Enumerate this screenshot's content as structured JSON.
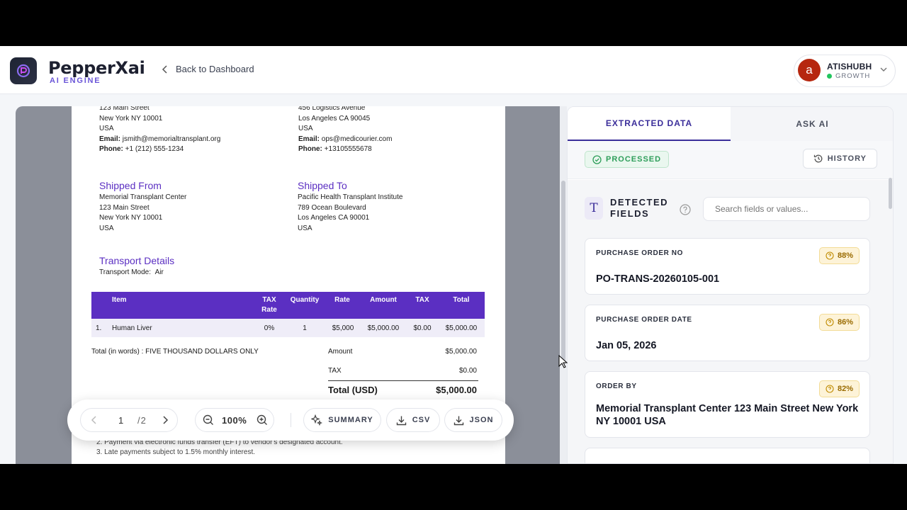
{
  "header": {
    "brand": "PepperXai",
    "brand_sub": "AI ENGINE",
    "back_label": "Back to Dashboard",
    "user": {
      "initial": "a",
      "name": "ATISHUBH",
      "plan": "GROWTH"
    }
  },
  "document": {
    "bill_from": {
      "l1": "123 Main Street",
      "l2": "New York NY  10001",
      "l3": "USA",
      "email_label": "Email:",
      "email": "jsmith@memorialtransplant.org",
      "phone_label": "Phone:",
      "phone": "+1 (212) 555-1234"
    },
    "bill_to": {
      "l0": "456 Logistics Avenue",
      "l1": "Los Angeles CA 90045",
      "l2": "USA",
      "email_label": "Email:",
      "email": "ops@medicourier.com",
      "phone_label": "Phone:",
      "phone": "+13105555678"
    },
    "shipped_from": {
      "title": "Shipped From",
      "l1": "Memorial Transplant Center",
      "l2": "123 Main Street",
      "l3": "New York NY  10001",
      "l4": "USA"
    },
    "shipped_to": {
      "title": "Shipped To",
      "l1": "Pacific Health Transplant Institute",
      "l2": "789 Ocean Boulevard",
      "l3": "Los Angeles CA 90001",
      "l4": "USA"
    },
    "transport": {
      "title": "Transport Details",
      "mode_label": "Transport Mode:",
      "mode": "Air"
    },
    "table": {
      "headers": {
        "item": "Item",
        "tax_rate_1": "TAX",
        "tax_rate_2": "Rate",
        "quantity": "Quantity",
        "rate": "Rate",
        "amount": "Amount",
        "tax": "TAX",
        "total": "Total"
      },
      "row": {
        "num": "1.",
        "item": "Human Liver",
        "tax_rate": "0%",
        "quantity": "1",
        "rate": "$5,000",
        "amount": "$5,000.00",
        "tax": "$0.00",
        "total": "$5,000.00"
      }
    },
    "total_words": "Total (in words) : FIVE THOUSAND DOLLARS ONLY",
    "summary": {
      "amount_label": "Amount",
      "amount": "$5,000.00",
      "tax_label": "TAX",
      "tax": "$0.00",
      "total_label": "Total (USD)",
      "total": "$5,000.00"
    },
    "notes": {
      "n2": "2. Payment via electronic funds transfer (EFT) to vendor's designated account.",
      "n3": "3. Late payments subject to 1.5% monthly interest."
    }
  },
  "toolbar": {
    "page": "1",
    "page_total": "/2",
    "zoom": "100%",
    "summary": "SUMMARY",
    "csv": "CSV",
    "json": "JSON"
  },
  "panel": {
    "tabs": {
      "extracted": "EXTRACTED DATA",
      "ask": "ASK AI"
    },
    "status": "PROCESSED",
    "history": "HISTORY",
    "fields_title_1": "DETECTED",
    "fields_title_2": "FIELDS",
    "search_placeholder": "Search fields or values...",
    "fields": [
      {
        "label": "PURCHASE ORDER NO",
        "confidence": "88%",
        "value": "PO-TRANS-20260105-001"
      },
      {
        "label": "PURCHASE ORDER DATE",
        "confidence": "86%",
        "value": "Jan 05, 2026"
      },
      {
        "label": "ORDER BY",
        "confidence": "82%",
        "value": "Memorial Transplant Center 123 Main Street New York NY 10001 USA"
      }
    ]
  },
  "colors": {
    "accent": "#5b2fc2",
    "brand_purple": "#6a55d8",
    "success": "#2e9e5a",
    "warning": "#9a6b00"
  }
}
